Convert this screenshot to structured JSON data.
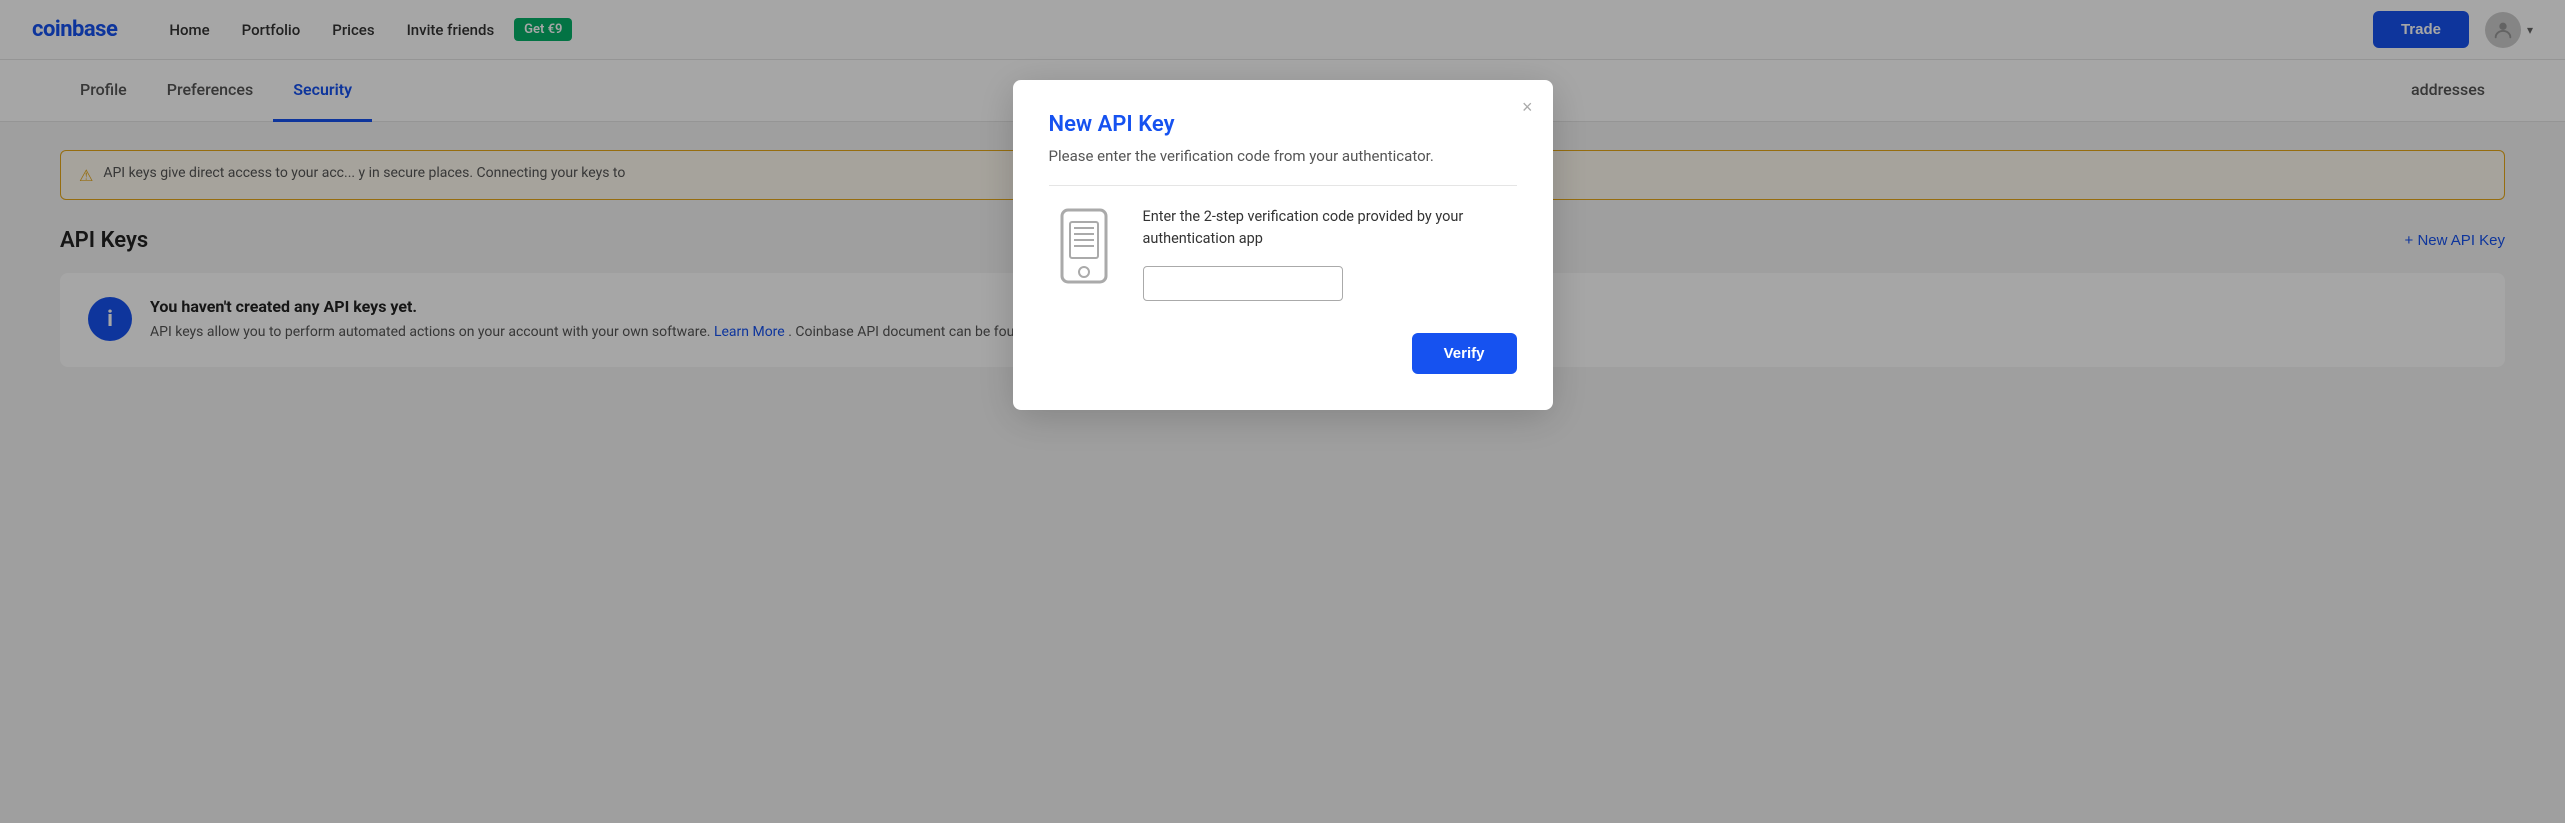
{
  "brand": {
    "name": "coinbase"
  },
  "navbar": {
    "nav_links": [
      {
        "id": "home",
        "label": "Home"
      },
      {
        "id": "portfolio",
        "label": "Portfolio"
      },
      {
        "id": "prices",
        "label": "Prices"
      },
      {
        "id": "invite",
        "label": "Invite friends"
      }
    ],
    "invite_badge": "Get €9",
    "trade_button": "Trade"
  },
  "tabs": [
    {
      "id": "profile",
      "label": "Profile"
    },
    {
      "id": "preferences",
      "label": "Preferences"
    },
    {
      "id": "security",
      "label": "Security"
    },
    {
      "id": "addresses",
      "label": "addresses"
    }
  ],
  "warning_banner": {
    "text": "API keys give direct access to your acc... y in secure places. Connecting your keys to"
  },
  "api_keys_section": {
    "title": "API Keys",
    "new_key_button": "+ New API Key"
  },
  "info_box": {
    "title": "You haven't created any API keys yet.",
    "body": "API keys allow you to perform automated actions on your account with your own software.",
    "learn_more": "Learn More",
    "body2": ". Coinbase API document can be found"
  },
  "modal": {
    "title": "New API Key",
    "subtitle": "Please enter the verification code from your authenticator.",
    "close_label": "×",
    "code_description": "Enter the 2-step verification code provided by your authentication app",
    "input_placeholder": "",
    "verify_button": "Verify"
  },
  "colors": {
    "brand_blue": "#1652f0",
    "green": "#05b169",
    "warning_yellow": "#e6a817"
  }
}
